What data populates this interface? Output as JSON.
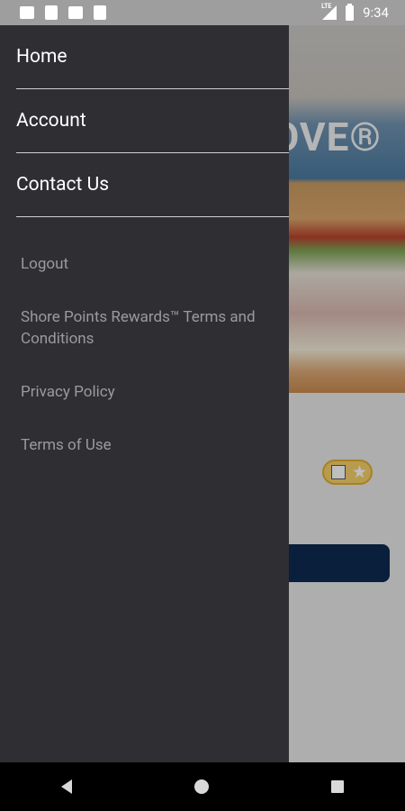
{
  "status_bar": {
    "time": "9:34",
    "network": "LTE",
    "left_icons": [
      "message-icon",
      "sim-icon",
      "missed-call-icon",
      "sd-card-icon"
    ],
    "right_icons": [
      "signal-icon",
      "battery-icon"
    ]
  },
  "background_app": {
    "hero_wordmark": "OVE®",
    "rewards_badge_icons": [
      "qr-code-icon",
      "star-icon"
    ]
  },
  "drawer": {
    "primary_items": [
      {
        "label": "Home"
      },
      {
        "label": "Account"
      },
      {
        "label": "Contact Us"
      }
    ],
    "secondary_items": [
      {
        "label": "Logout"
      },
      {
        "label": "Shore Points Rewards™ Terms and Conditions"
      },
      {
        "label": "Privacy Policy"
      },
      {
        "label": "Terms of Use"
      }
    ]
  },
  "colors": {
    "drawer_bg": "#2f2e33",
    "primary_text": "#ffffff",
    "secondary_text": "#9b9b9b",
    "accent_navy": "#0d2a4f",
    "rewards_gold": "#f4d06b"
  },
  "nav_bar": {
    "buttons": [
      "back-icon",
      "home-icon",
      "recents-icon"
    ]
  }
}
